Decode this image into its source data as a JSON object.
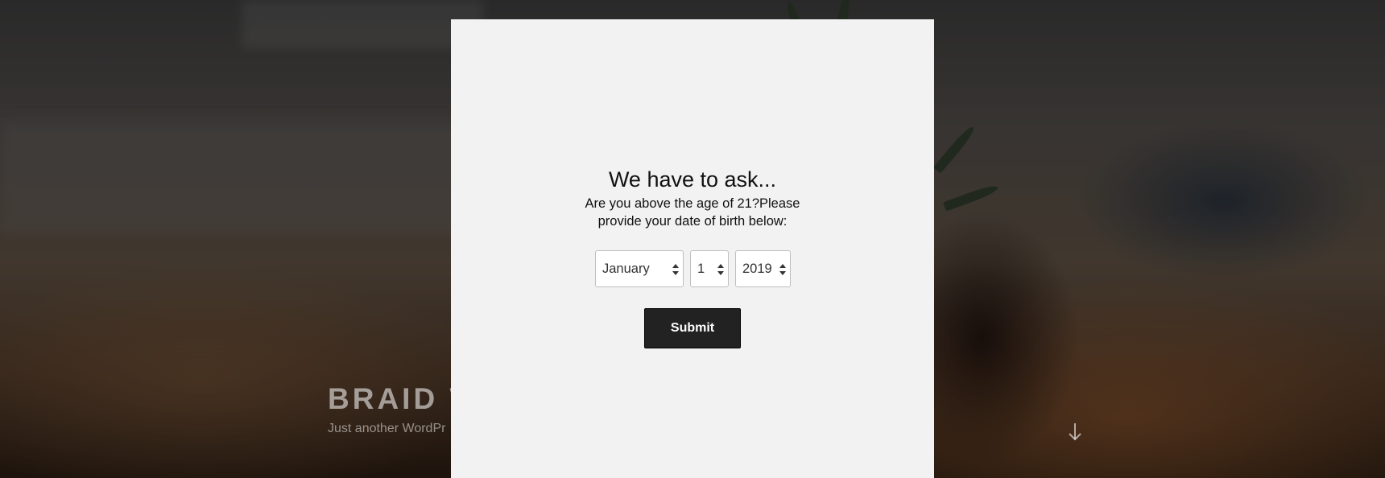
{
  "background": {
    "site_title": "BRAID W",
    "site_tagline": "Just another WordPr",
    "scroll_icon": "arrow-down-icon"
  },
  "age_gate": {
    "title": "We have to ask...",
    "message_line1": "Are you above the age of 21?Please",
    "message_line2": "provide your date of birth below:",
    "month": {
      "selected": "January",
      "icon": "select-arrows-icon"
    },
    "day": {
      "selected": "1",
      "icon": "select-arrows-icon"
    },
    "year": {
      "selected": "2019",
      "icon": "select-arrows-icon"
    },
    "submit_label": "Submit"
  },
  "colors": {
    "modal_background": "#f2f2f2",
    "button_background": "#222222",
    "button_text": "#ffffff"
  }
}
